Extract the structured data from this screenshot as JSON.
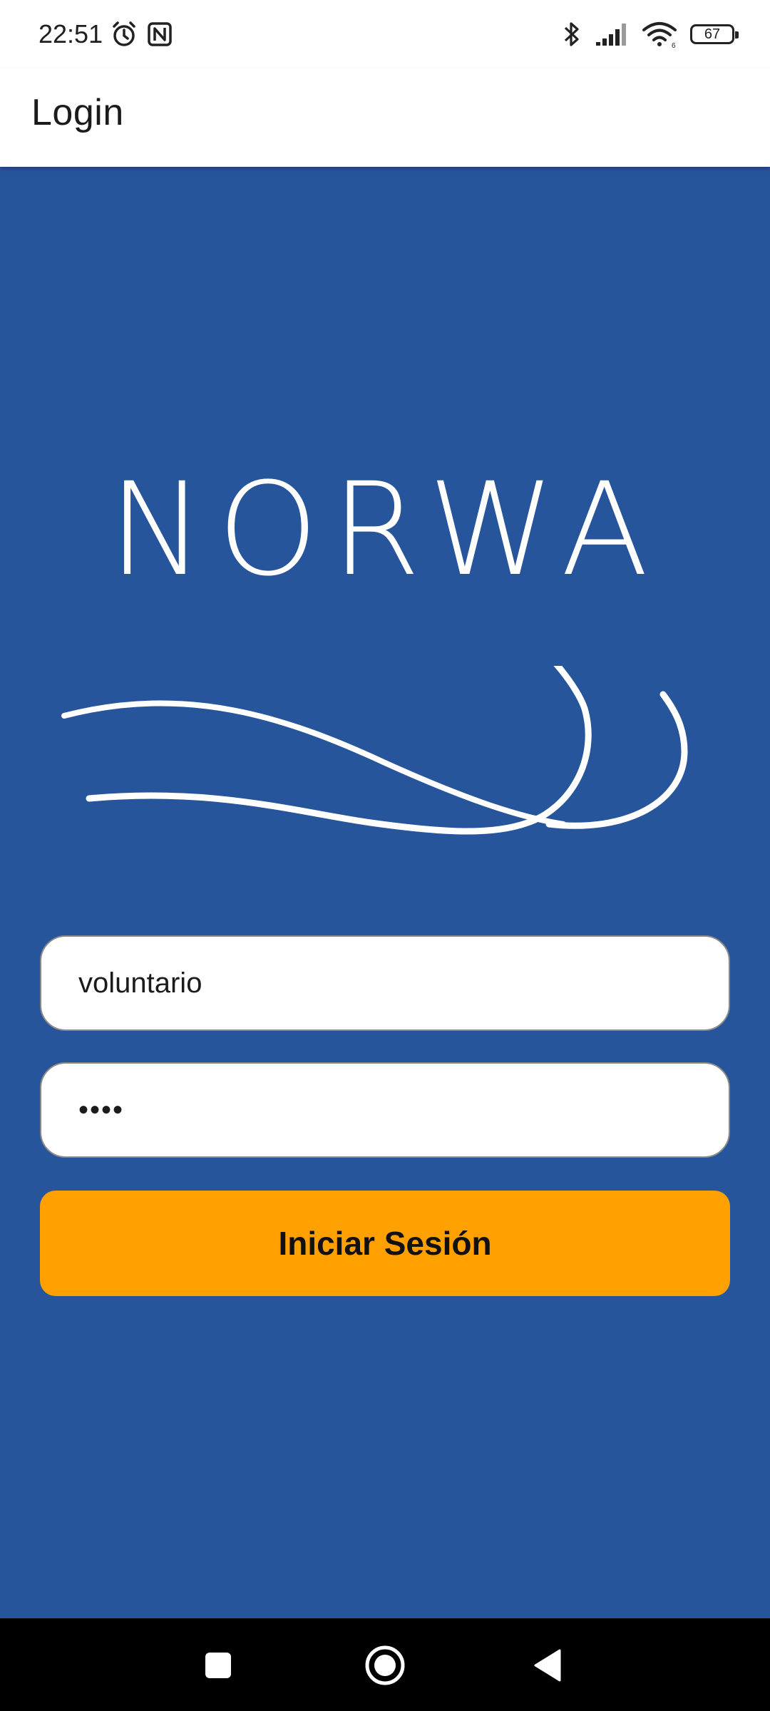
{
  "status_bar": {
    "time": "22:51",
    "battery_level": "67",
    "icons": [
      "alarm-icon",
      "nfc-icon",
      "bluetooth-icon",
      "signal-icon",
      "wifi-icon",
      "battery-icon"
    ]
  },
  "app_bar": {
    "title": "Login"
  },
  "logo": {
    "brand_text": "NORWA"
  },
  "form": {
    "username_value": "voluntario",
    "password_value": "••••",
    "submit_label": "Iniciar Sesión"
  },
  "nav_bar": {
    "buttons": [
      "recents-icon",
      "home-icon",
      "back-icon"
    ]
  },
  "colors": {
    "background": "#27559b",
    "accent_button": "#fea000",
    "app_bar": "#ffffff",
    "nav_bar": "#000000"
  }
}
